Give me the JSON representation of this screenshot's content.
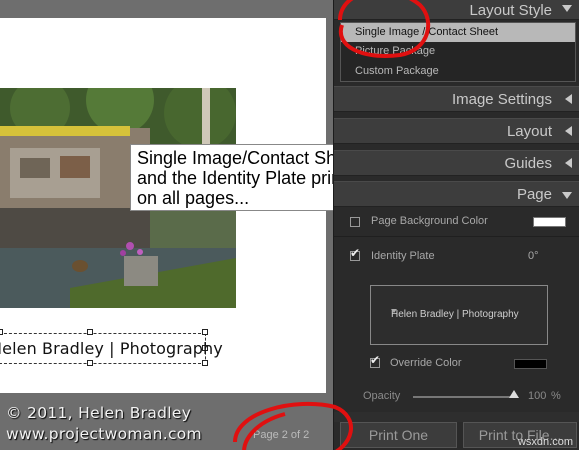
{
  "callout": {
    "line1": "Single Image/Contact Sheet",
    "line2": "and the Identity Plate prints",
    "line3": "on all pages..."
  },
  "preview": {
    "identity_plate_text": "Helen Bradley | Photography",
    "copyright_line1": "© 2011, Helen Bradley",
    "copyright_line2": "www.projectwoman.com",
    "page_count": "Page 2 of 2"
  },
  "panel": {
    "layout_style": {
      "title": "Layout Style"
    },
    "layout_options": [
      {
        "label": "Single Image / Contact Sheet",
        "selected": true
      },
      {
        "label": "Picture Package",
        "selected": false
      },
      {
        "label": "Custom Package",
        "selected": false
      }
    ],
    "sections": {
      "image_settings": "Image Settings",
      "layout": "Layout",
      "guides": "Guides",
      "page": "Page"
    },
    "page": {
      "bg_color_label": "Page Background Color",
      "bg_color_checked": false,
      "bg_color": "#ffffff",
      "identity_plate_label": "Identity Plate",
      "identity_plate_checked": true,
      "identity_plate_angle": "0°",
      "identity_plate_preview_text": "Helen Bradley | Photography",
      "override_color_label": "Override Color",
      "override_color_checked": true,
      "override_color": "#000000",
      "opacity_label": "Opacity",
      "opacity_value": "100",
      "opacity_unit": "%",
      "opacity_fraction": 1.0
    },
    "buttons": {
      "print_one": "Print One",
      "print_to_file": "Print to File..."
    }
  },
  "watermark": "wsxdn.com",
  "colors": {
    "annotation_red": "#e01010",
    "panel_bg": "#2a2a2a",
    "header_bg": "#3d3d3d"
  }
}
